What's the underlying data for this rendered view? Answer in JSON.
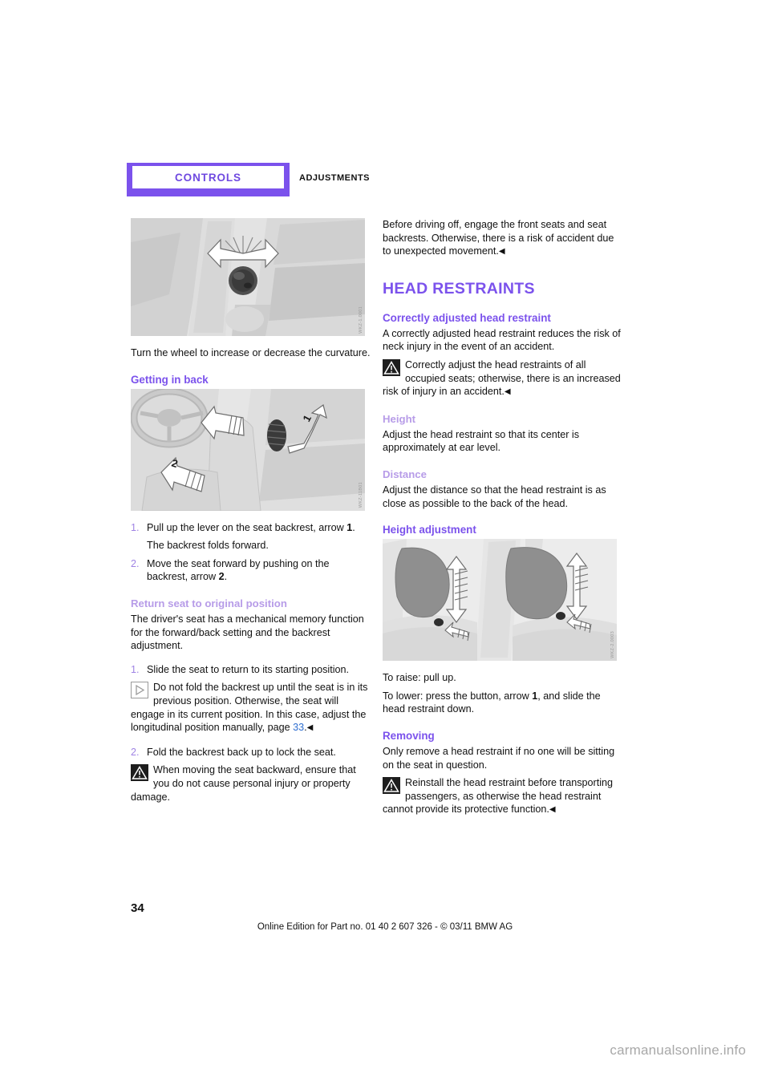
{
  "header": {
    "chapter": "CONTROLS",
    "section": "ADJUSTMENTS",
    "tab_color": "#7b52ec",
    "chapter_color": "#6f49e0"
  },
  "left_column": {
    "figure_lumbar": {
      "icon": "lumbar-support-wheel-photo",
      "code": "WKZ-1.0001"
    },
    "lumbar_text": "Turn the wheel to increase or decrease the curvature.",
    "getting_in_back_heading": "Getting in back",
    "figure_seat": {
      "icon": "front-seat-tilt-lever-photo",
      "code": "WKZ-11B01"
    },
    "steps_getting_in": [
      {
        "num": "1.",
        "text_pre": "Pull up the lever on the seat backrest, arrow ",
        "bold": "1",
        "text_post": "."
      },
      {
        "num": "2.",
        "text_pre": "Move the seat forward by pushing on the backrest, arrow ",
        "bold": "2",
        "text_post": "."
      }
    ],
    "step1_result": "The backrest folds forward.",
    "return_seat_heading": "Return seat to original position",
    "return_seat_text": "The driver's seat has a mechanical memory function for the forward/back setting and the backrest adjustment.",
    "steps_return": [
      {
        "num": "1.",
        "text": "Slide the seat to return to its starting position."
      },
      {
        "num": "2.",
        "text": "Fold the backrest back up to lock the seat."
      }
    ],
    "note_backrest": {
      "icon": "note-triangle-icon",
      "text_pre": "Do not fold the backrest up until the seat is in its previous position. Otherwise, the seat will engage in its current position. In this case, adjust the longitudinal position manually, page ",
      "page_ref": "33",
      "text_post": ".",
      "end_mark": "◀"
    },
    "warning_backward": {
      "icon": "warning-triangle-icon",
      "text": "When moving the seat backward, ensure that you do not cause personal injury or property damage."
    }
  },
  "right_column": {
    "intro_warning_continued": {
      "text": "Before driving off, engage the front seats and seat backrests. Otherwise, there is a risk of accident due to unexpected movement.",
      "end_mark": "◀"
    },
    "head_restraints_heading": "HEAD RESTRAINTS",
    "correctly_adjusted_heading": "Correctly adjusted head restraint",
    "correctly_adjusted_text": "A correctly adjusted head restraint reduces the risk of neck injury in the event of an accident.",
    "warning_adjust": {
      "icon": "warning-triangle-icon",
      "text": "Correctly adjust the head restraints of all occupied seats; otherwise, there is an increased risk of injury in an accident.",
      "end_mark": "◀"
    },
    "height_heading": "Height",
    "height_text": "Adjust the head restraint so that its center is approximately at ear level.",
    "distance_heading": "Distance",
    "distance_text": "Adjust the distance so that the head restraint is as close as possible to the back of the head.",
    "height_adjustment_heading": "Height adjustment",
    "figure_head_restraints": {
      "icon": "rear-head-restraints-photo",
      "code": "WKZ-2.0003"
    },
    "raise_text": "To raise: pull up.",
    "lower_text_pre": "To lower: press the button, arrow ",
    "lower_bold": "1",
    "lower_text_post": ", and slide the head restraint down.",
    "removing_heading": "Removing",
    "removing_text": "Only remove a head restraint if no one will be sitting on the seat in question.",
    "warning_reinstall": {
      "icon": "warning-triangle-icon",
      "text": "Reinstall the head restraint before transporting passengers, as otherwise the head restraint cannot provide its protective function.",
      "end_mark": "◀"
    }
  },
  "footer": {
    "page_number": "34",
    "edition_line": "Online Edition for Part no. 01 40 2 607 326 - © 03/11 BMW AG",
    "watermark": "carmanualsonline.info"
  }
}
